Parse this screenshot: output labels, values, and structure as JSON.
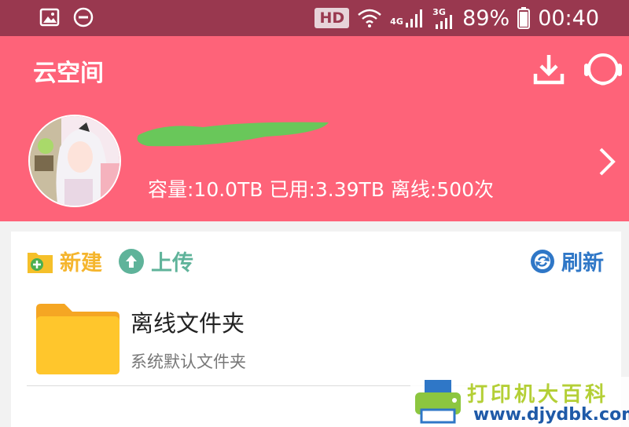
{
  "status_bar": {
    "hd": "HD",
    "net_4g": "4G",
    "net_3g": "3G",
    "battery": "89%",
    "time": "00:40"
  },
  "app_bar": {
    "title": "云空间",
    "quota_text": "容量:10.0TB 已用:3.39TB 离线:500次"
  },
  "toolbar": {
    "new_label": "新建",
    "upload_label": "上传",
    "refresh_label": "刷新"
  },
  "files": [
    {
      "name": "离线文件夹",
      "description": "系统默认文件夹"
    }
  ],
  "watermark": {
    "title": "打印机大百科",
    "url": "www.djydbk.com"
  },
  "colors": {
    "status_bar": "#99384f",
    "header": "#fe6379",
    "folder": "#ffc62c",
    "new": "#f5b52d",
    "upload": "#5fb39a",
    "refresh": "#2f77c7"
  }
}
